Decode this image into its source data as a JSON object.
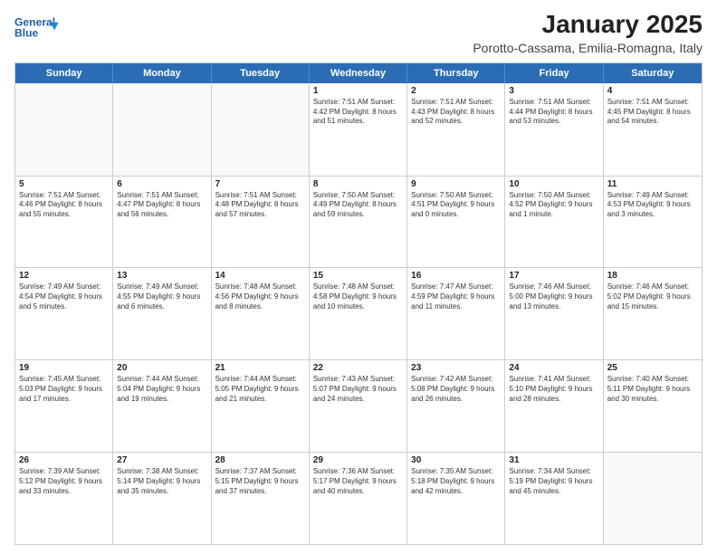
{
  "logo": {
    "line1": "General",
    "line2": "Blue"
  },
  "title": "January 2025",
  "location": "Porotto-Cassama, Emilia-Romagna, Italy",
  "weekdays": [
    "Sunday",
    "Monday",
    "Tuesday",
    "Wednesday",
    "Thursday",
    "Friday",
    "Saturday"
  ],
  "weeks": [
    [
      {
        "day": "",
        "empty": true,
        "text": ""
      },
      {
        "day": "",
        "empty": true,
        "text": ""
      },
      {
        "day": "",
        "empty": true,
        "text": ""
      },
      {
        "day": "1",
        "text": "Sunrise: 7:51 AM\nSunset: 4:42 PM\nDaylight: 8 hours and 51 minutes."
      },
      {
        "day": "2",
        "text": "Sunrise: 7:51 AM\nSunset: 4:43 PM\nDaylight: 8 hours and 52 minutes."
      },
      {
        "day": "3",
        "text": "Sunrise: 7:51 AM\nSunset: 4:44 PM\nDaylight: 8 hours and 53 minutes."
      },
      {
        "day": "4",
        "text": "Sunrise: 7:51 AM\nSunset: 4:45 PM\nDaylight: 8 hours and 54 minutes."
      }
    ],
    [
      {
        "day": "5",
        "text": "Sunrise: 7:51 AM\nSunset: 4:46 PM\nDaylight: 8 hours and 55 minutes."
      },
      {
        "day": "6",
        "text": "Sunrise: 7:51 AM\nSunset: 4:47 PM\nDaylight: 8 hours and 56 minutes."
      },
      {
        "day": "7",
        "text": "Sunrise: 7:51 AM\nSunset: 4:48 PM\nDaylight: 8 hours and 57 minutes."
      },
      {
        "day": "8",
        "text": "Sunrise: 7:50 AM\nSunset: 4:49 PM\nDaylight: 8 hours and 59 minutes."
      },
      {
        "day": "9",
        "text": "Sunrise: 7:50 AM\nSunset: 4:51 PM\nDaylight: 9 hours and 0 minutes."
      },
      {
        "day": "10",
        "text": "Sunrise: 7:50 AM\nSunset: 4:52 PM\nDaylight: 9 hours and 1 minute."
      },
      {
        "day": "11",
        "text": "Sunrise: 7:49 AM\nSunset: 4:53 PM\nDaylight: 9 hours and 3 minutes."
      }
    ],
    [
      {
        "day": "12",
        "text": "Sunrise: 7:49 AM\nSunset: 4:54 PM\nDaylight: 9 hours and 5 minutes."
      },
      {
        "day": "13",
        "text": "Sunrise: 7:49 AM\nSunset: 4:55 PM\nDaylight: 9 hours and 6 minutes."
      },
      {
        "day": "14",
        "text": "Sunrise: 7:48 AM\nSunset: 4:56 PM\nDaylight: 9 hours and 8 minutes."
      },
      {
        "day": "15",
        "text": "Sunrise: 7:48 AM\nSunset: 4:58 PM\nDaylight: 9 hours and 10 minutes."
      },
      {
        "day": "16",
        "text": "Sunrise: 7:47 AM\nSunset: 4:59 PM\nDaylight: 9 hours and 11 minutes."
      },
      {
        "day": "17",
        "text": "Sunrise: 7:46 AM\nSunset: 5:00 PM\nDaylight: 9 hours and 13 minutes."
      },
      {
        "day": "18",
        "text": "Sunrise: 7:46 AM\nSunset: 5:02 PM\nDaylight: 9 hours and 15 minutes."
      }
    ],
    [
      {
        "day": "19",
        "text": "Sunrise: 7:45 AM\nSunset: 5:03 PM\nDaylight: 9 hours and 17 minutes."
      },
      {
        "day": "20",
        "text": "Sunrise: 7:44 AM\nSunset: 5:04 PM\nDaylight: 9 hours and 19 minutes."
      },
      {
        "day": "21",
        "text": "Sunrise: 7:44 AM\nSunset: 5:05 PM\nDaylight: 9 hours and 21 minutes."
      },
      {
        "day": "22",
        "text": "Sunrise: 7:43 AM\nSunset: 5:07 PM\nDaylight: 9 hours and 24 minutes."
      },
      {
        "day": "23",
        "text": "Sunrise: 7:42 AM\nSunset: 5:08 PM\nDaylight: 9 hours and 26 minutes."
      },
      {
        "day": "24",
        "text": "Sunrise: 7:41 AM\nSunset: 5:10 PM\nDaylight: 9 hours and 28 minutes."
      },
      {
        "day": "25",
        "text": "Sunrise: 7:40 AM\nSunset: 5:11 PM\nDaylight: 9 hours and 30 minutes."
      }
    ],
    [
      {
        "day": "26",
        "text": "Sunrise: 7:39 AM\nSunset: 5:12 PM\nDaylight: 9 hours and 33 minutes."
      },
      {
        "day": "27",
        "text": "Sunrise: 7:38 AM\nSunset: 5:14 PM\nDaylight: 9 hours and 35 minutes."
      },
      {
        "day": "28",
        "text": "Sunrise: 7:37 AM\nSunset: 5:15 PM\nDaylight: 9 hours and 37 minutes."
      },
      {
        "day": "29",
        "text": "Sunrise: 7:36 AM\nSunset: 5:17 PM\nDaylight: 9 hours and 40 minutes."
      },
      {
        "day": "30",
        "text": "Sunrise: 7:35 AM\nSunset: 5:18 PM\nDaylight: 9 hours and 42 minutes."
      },
      {
        "day": "31",
        "text": "Sunrise: 7:34 AM\nSunset: 5:19 PM\nDaylight: 9 hours and 45 minutes."
      },
      {
        "day": "",
        "empty": true,
        "text": ""
      }
    ]
  ]
}
